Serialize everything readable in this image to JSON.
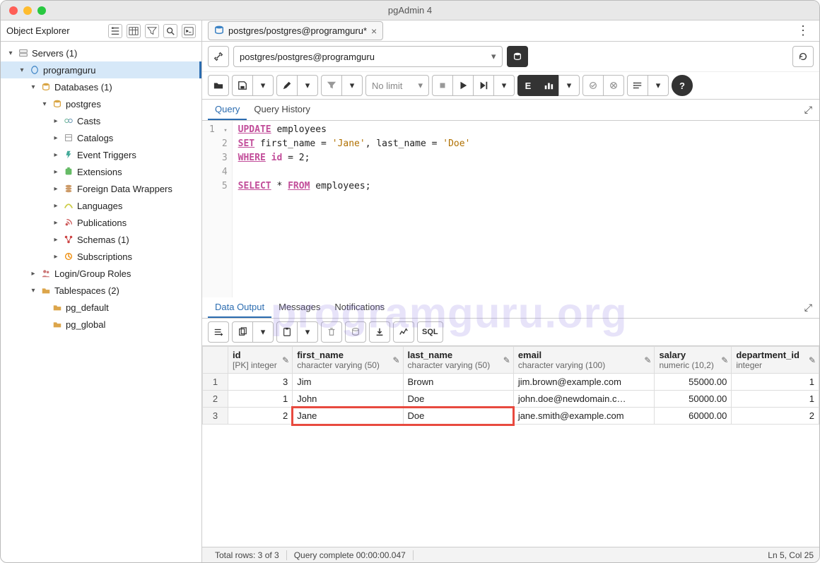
{
  "window": {
    "title": "pgAdmin 4"
  },
  "sidebar": {
    "title": "Object Explorer",
    "items": [
      {
        "ind": 0,
        "arrow": "▾",
        "icon": "server-group",
        "label": "Servers (1)"
      },
      {
        "ind": 1,
        "arrow": "▾",
        "icon": "server",
        "label": "programguru",
        "selected": true
      },
      {
        "ind": 2,
        "arrow": "▾",
        "icon": "database-group",
        "label": "Databases (1)"
      },
      {
        "ind": 3,
        "arrow": "▾",
        "icon": "database",
        "label": "postgres"
      },
      {
        "ind": 4,
        "arrow": "▸",
        "icon": "casts",
        "label": "Casts"
      },
      {
        "ind": 4,
        "arrow": "▸",
        "icon": "catalogs",
        "label": "Catalogs"
      },
      {
        "ind": 4,
        "arrow": "▸",
        "icon": "event-triggers",
        "label": "Event Triggers"
      },
      {
        "ind": 4,
        "arrow": "▸",
        "icon": "extensions",
        "label": "Extensions"
      },
      {
        "ind": 4,
        "arrow": "▸",
        "icon": "fdw",
        "label": "Foreign Data Wrappers"
      },
      {
        "ind": 4,
        "arrow": "▸",
        "icon": "languages",
        "label": "Languages"
      },
      {
        "ind": 4,
        "arrow": "▸",
        "icon": "publications",
        "label": "Publications"
      },
      {
        "ind": 4,
        "arrow": "▸",
        "icon": "schemas",
        "label": "Schemas (1)"
      },
      {
        "ind": 4,
        "arrow": "▸",
        "icon": "subscriptions",
        "label": "Subscriptions"
      },
      {
        "ind": 2,
        "arrow": "▸",
        "icon": "roles",
        "label": "Login/Group Roles"
      },
      {
        "ind": 2,
        "arrow": "▾",
        "icon": "tablespaces",
        "label": "Tablespaces (2)"
      },
      {
        "ind": 3,
        "arrow": "",
        "icon": "tablespace",
        "label": "pg_default"
      },
      {
        "ind": 3,
        "arrow": "",
        "icon": "tablespace",
        "label": "pg_global"
      }
    ]
  },
  "tab": {
    "label": "postgres/postgres@programguru*"
  },
  "connection": {
    "value": "postgres/postgres@programguru"
  },
  "toolbar": {
    "nolimit": "No limit"
  },
  "queryTabs": {
    "query": "Query",
    "history": "Query History"
  },
  "editor": {
    "dd_arrow": "▾"
  },
  "code": {
    "l1a": "UPDATE",
    "l1b": " employees",
    "l2a": "SET",
    "l2b": " first_name = ",
    "l2c": "'Jane'",
    "l2d": ", last_name = ",
    "l2e": "'Doe'",
    "l3a": "WHERE",
    "l3b": " ",
    "l3c": "id",
    "l3d": " = 2;",
    "l5a": "SELECT",
    "l5b": " * ",
    "l5c": "FROM",
    "l5d": " employees;"
  },
  "outTabs": {
    "data": "Data Output",
    "messages": "Messages",
    "notif": "Notifications"
  },
  "outToolbar": {
    "sql": "SQL"
  },
  "grid": {
    "cols": [
      {
        "name": "id",
        "type": "[PK] integer"
      },
      {
        "name": "first_name",
        "type": "character varying (50)"
      },
      {
        "name": "last_name",
        "type": "character varying (50)"
      },
      {
        "name": "email",
        "type": "character varying (100)"
      },
      {
        "name": "salary",
        "type": "numeric (10,2)"
      },
      {
        "name": "department_id",
        "type": "integer"
      }
    ],
    "rows": [
      {
        "n": "1",
        "id": "3",
        "first_name": "Jim",
        "last_name": "Brown",
        "email": "jim.brown@example.com",
        "salary": "55000.00",
        "department_id": "1"
      },
      {
        "n": "2",
        "id": "1",
        "first_name": "John",
        "last_name": "Doe",
        "email": "john.doe@newdomain.c…",
        "salary": "50000.00",
        "department_id": "1"
      },
      {
        "n": "3",
        "id": "2",
        "first_name": "Jane",
        "last_name": "Doe",
        "email": "jane.smith@example.com",
        "salary": "60000.00",
        "department_id": "2"
      }
    ]
  },
  "status": {
    "rows": "Total rows: 3 of 3",
    "complete": "Query complete 00:00:00.047",
    "cursor": "Ln 5, Col 25"
  },
  "watermark": "programguru.org"
}
